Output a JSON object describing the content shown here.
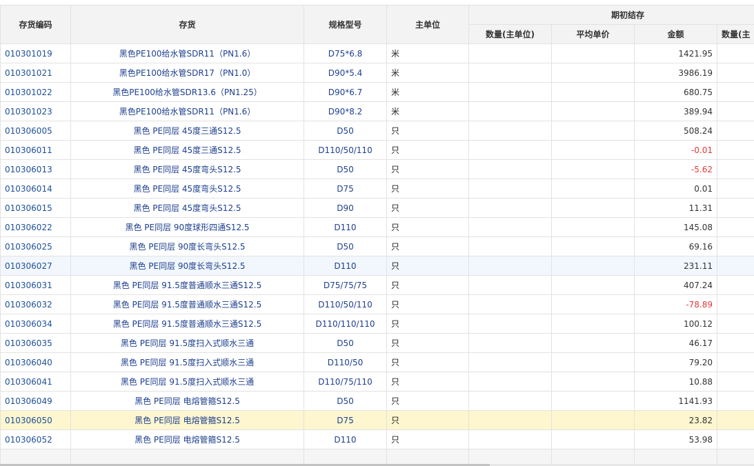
{
  "header": {
    "code": "存货编码",
    "item": "存货",
    "spec": "规格型号",
    "unit": "主单位",
    "opening_group": "期初结存",
    "qty": "数量(主单位)",
    "avg_price": "平均单价",
    "amount": "金额",
    "qty2": "数量(主"
  },
  "rows": [
    {
      "code": "010301019",
      "name": "黑色PE100给水管SDR11（PN1.6）",
      "spec": "D75*6.8",
      "unit": "米",
      "qty": "",
      "price": "",
      "amount": "1421.95"
    },
    {
      "code": "010301021",
      "name": "黑色PE100给水管SDR17（PN1.0）",
      "spec": "D90*5.4",
      "unit": "米",
      "qty": "",
      "price": "",
      "amount": "3986.19"
    },
    {
      "code": "010301022",
      "name": "黑色PE100给水管SDR13.6（PN1.25）",
      "spec": "D90*6.7",
      "unit": "米",
      "qty": "",
      "price": "",
      "amount": "680.75"
    },
    {
      "code": "010301023",
      "name": "黑色PE100给水管SDR11（PN1.6）",
      "spec": "D90*8.2",
      "unit": "米",
      "qty": "",
      "price": "",
      "amount": "389.94"
    },
    {
      "code": "010306005",
      "name": "黑色 PE同层 45度三通S12.5",
      "spec": "D50",
      "unit": "只",
      "qty": "",
      "price": "",
      "amount": "508.24"
    },
    {
      "code": "010306011",
      "name": "黑色 PE同层 45度三通S12.5",
      "spec": "D110/50/110",
      "unit": "只",
      "qty": "",
      "price": "",
      "amount": "-0.01"
    },
    {
      "code": "010306013",
      "name": "黑色 PE同层 45度弯头S12.5",
      "spec": "D50",
      "unit": "只",
      "qty": "",
      "price": "",
      "amount": "-5.62"
    },
    {
      "code": "010306014",
      "name": "黑色 PE同层 45度弯头S12.5",
      "spec": "D75",
      "unit": "只",
      "qty": "",
      "price": "",
      "amount": "0.01"
    },
    {
      "code": "010306015",
      "name": "黑色 PE同层 45度弯头S12.5",
      "spec": "D90",
      "unit": "只",
      "qty": "",
      "price": "",
      "amount": "11.31"
    },
    {
      "code": "010306022",
      "name": "黑色 PE同层 90度球形四通S12.5",
      "spec": "D110",
      "unit": "只",
      "qty": "",
      "price": "",
      "amount": "145.08"
    },
    {
      "code": "010306025",
      "name": "黑色 PE同层 90度长弯头S12.5",
      "spec": "D50",
      "unit": "只",
      "qty": "",
      "price": "",
      "amount": "69.16"
    },
    {
      "code": "010306027",
      "name": "黑色 PE同层 90度长弯头S12.5",
      "spec": "D110",
      "unit": "只",
      "qty": "",
      "price": "",
      "amount": "231.11"
    },
    {
      "code": "010306031",
      "name": "黑色 PE同层 91.5度普通顺水三通S12.5",
      "spec": "D75/75/75",
      "unit": "只",
      "qty": "",
      "price": "",
      "amount": "407.24"
    },
    {
      "code": "010306032",
      "name": "黑色 PE同层 91.5度普通顺水三通S12.5",
      "spec": "D110/50/110",
      "unit": "只",
      "qty": "",
      "price": "",
      "amount": "-78.89"
    },
    {
      "code": "010306034",
      "name": "黑色 PE同层 91.5度普通顺水三通S12.5",
      "spec": "D110/110/110",
      "unit": "只",
      "qty": "",
      "price": "",
      "amount": "100.12"
    },
    {
      "code": "010306035",
      "name": "黑色 PE同层 91.5度扫入式顺水三通",
      "spec": "D50",
      "unit": "只",
      "qty": "",
      "price": "",
      "amount": "46.17"
    },
    {
      "code": "010306040",
      "name": "黑色 PE同层 91.5度扫入式顺水三通",
      "spec": "D110/50",
      "unit": "只",
      "qty": "",
      "price": "",
      "amount": "79.20"
    },
    {
      "code": "010306041",
      "name": "黑色 PE同层 91.5度扫入式顺水三通",
      "spec": "D110/75/110",
      "unit": "只",
      "qty": "",
      "price": "",
      "amount": "10.88"
    },
    {
      "code": "010306049",
      "name": "黑色 PE同层 电熔管箍S12.5",
      "spec": "D50",
      "unit": "只",
      "qty": "",
      "price": "",
      "amount": "1141.93"
    },
    {
      "code": "010306050",
      "name": "黑色 PE同层 电熔管箍S12.5",
      "spec": "D75",
      "unit": "只",
      "qty": "",
      "price": "",
      "amount": "23.82"
    },
    {
      "code": "010306052",
      "name": "黑色 PE同层 电熔管箍S12.5",
      "spec": "D110",
      "unit": "只",
      "qty": "",
      "price": "",
      "amount": "53.98"
    }
  ],
  "state": {
    "hover_row_code": "010306027",
    "selected_row_code": "010306050"
  },
  "colors": {
    "negative_amount": "#e53935",
    "link_text": "#1d4f9a",
    "selected_row": "#fdf6cf",
    "hover_row": "#f2f7fd",
    "header_bg": "#f3f3f3"
  }
}
